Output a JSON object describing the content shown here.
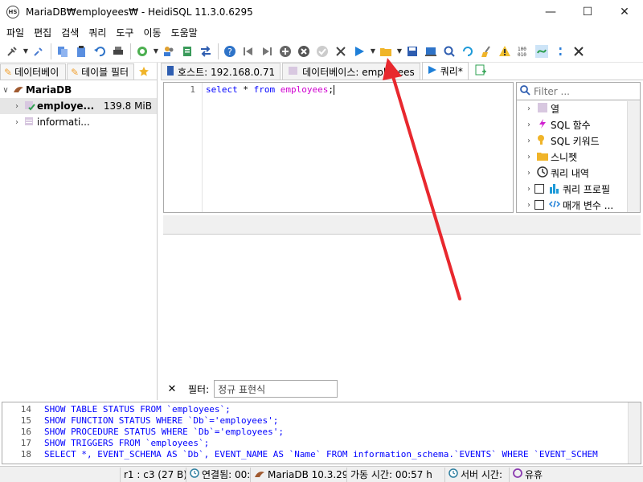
{
  "window": {
    "title": "MariaDB₩employees₩ - HeidiSQL 11.3.0.6295",
    "app_icon_text": "HS",
    "minimize": "—",
    "maximize": "☐",
    "close": "✕"
  },
  "menu": [
    "파일",
    "편집",
    "검색",
    "쿼리",
    "도구",
    "이동",
    "도움말"
  ],
  "left_panel": {
    "tabs": [
      "데이터베이",
      "테이블 필터"
    ],
    "tree": {
      "root": "MariaDB",
      "items": [
        {
          "name": "employe...",
          "size": "139.8 MiB"
        },
        {
          "name": "informati..."
        }
      ]
    }
  },
  "main_tabs": [
    {
      "label": "호스트: 192.168.0.71"
    },
    {
      "label": "데이터베이스: employees"
    },
    {
      "label": "쿼리*"
    }
  ],
  "editor": {
    "line": "1",
    "code": [
      {
        "t": "select",
        "c": "kw"
      },
      {
        "t": " * ",
        "c": "sym"
      },
      {
        "t": "from",
        "c": "kw"
      },
      {
        "t": " employees",
        "c": "ident"
      },
      {
        "t": ";",
        "c": "sym"
      }
    ]
  },
  "helper": {
    "filter_placeholder": "Filter ...",
    "items": [
      {
        "label": "열"
      },
      {
        "label": "SQL 함수"
      },
      {
        "label": "SQL 키워드"
      },
      {
        "label": "스니펫"
      },
      {
        "label": "쿼리 내역"
      },
      {
        "label": "쿼리 프로필"
      },
      {
        "label": "매개 변수 ..."
      }
    ]
  },
  "filter_row": {
    "label": "필터:",
    "placeholder": "정규 표현식"
  },
  "log": {
    "line_numbers": [
      "14",
      "15",
      "16",
      "17",
      "18"
    ],
    "lines": [
      "SHOW TABLE STATUS FROM `employees`;",
      "SHOW FUNCTION STATUS WHERE `Db`='employees';",
      "SHOW PROCEDURE STATUS WHERE `Db`='employees';",
      "SHOW TRIGGERS FROM `employees`;",
      "SELECT *, EVENT_SCHEMA AS `Db`, EVENT_NAME AS `Name` FROM information_schema.`EVENTS` WHERE `EVENT_SCHEM"
    ]
  },
  "status": {
    "cursor": "r1 : c3 (27 B)",
    "connected": "연결됨: 00:",
    "server": "MariaDB 10.3.29",
    "uptime": "가동 시간: 00:57 h",
    "server_time": "서버 시간:",
    "idle": "유휴"
  },
  "colors": {
    "annotation_arrow": "#e8282e",
    "keyword": "#0000ff",
    "identifier": "#d000d0"
  }
}
